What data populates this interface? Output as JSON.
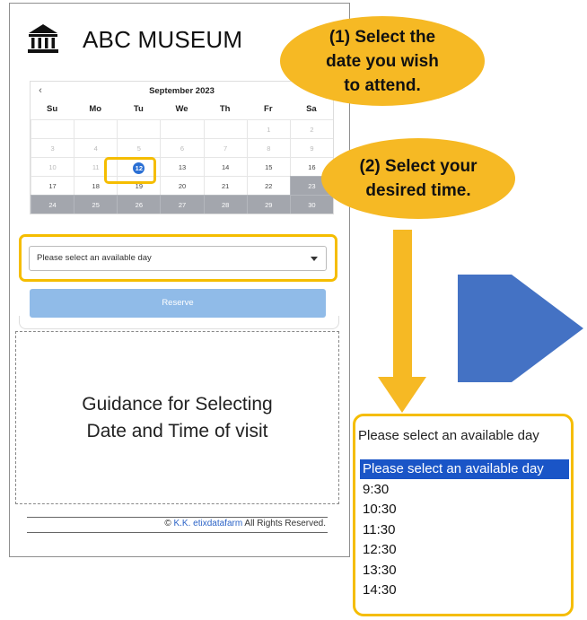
{
  "header": {
    "icon": "museum-icon",
    "title": "ABC MUSEUM"
  },
  "calendar": {
    "month_label": "September 2023",
    "prev_label": "‹",
    "weekdays": [
      "Su",
      "Mo",
      "Tu",
      "We",
      "Th",
      "Fr",
      "Sa"
    ],
    "selected_day": "12",
    "weeks": [
      [
        "",
        "",
        "",
        "",
        "",
        "1",
        "2"
      ],
      [
        "3",
        "4",
        "5",
        "6",
        "7",
        "8",
        "9"
      ],
      [
        "10",
        "11",
        "12",
        "13",
        "14",
        "15",
        "16"
      ],
      [
        "17",
        "18",
        "19",
        "20",
        "21",
        "22",
        "23"
      ],
      [
        "24",
        "25",
        "26",
        "27",
        "28",
        "29",
        "30"
      ]
    ],
    "available_days": [
      "12",
      "13",
      "14",
      "15",
      "16",
      "17",
      "18",
      "19",
      "20",
      "21",
      "22"
    ],
    "closed_days": [
      "23",
      "24",
      "25",
      "26",
      "27",
      "28",
      "29",
      "30"
    ]
  },
  "time_select": {
    "value": "Please select an available day"
  },
  "reserve_button": {
    "label": "Reserve"
  },
  "guidance": {
    "text": "Guidance for Selecting\nDate and Time of visit"
  },
  "footer": {
    "prefix": "© ",
    "company": "K.K. etixdatafarm",
    "suffix": " All Rights Reserved."
  },
  "callouts": {
    "step1": "(1) Select the\ndate you wish\nto attend.",
    "step2": "(2) Select your\ndesired time."
  },
  "dropdown": {
    "current": "Please select an available day",
    "options": [
      "Please select an available day",
      "9:30",
      "10:30",
      "11:30",
      "12:30",
      "13:30",
      "14:30"
    ],
    "selected_index": 0
  },
  "colors": {
    "highlight": "#f5bd00",
    "callout": "#f6b924",
    "arrow": "#4472c4",
    "selected": "#1a55c7",
    "button": "#90bbe8"
  }
}
